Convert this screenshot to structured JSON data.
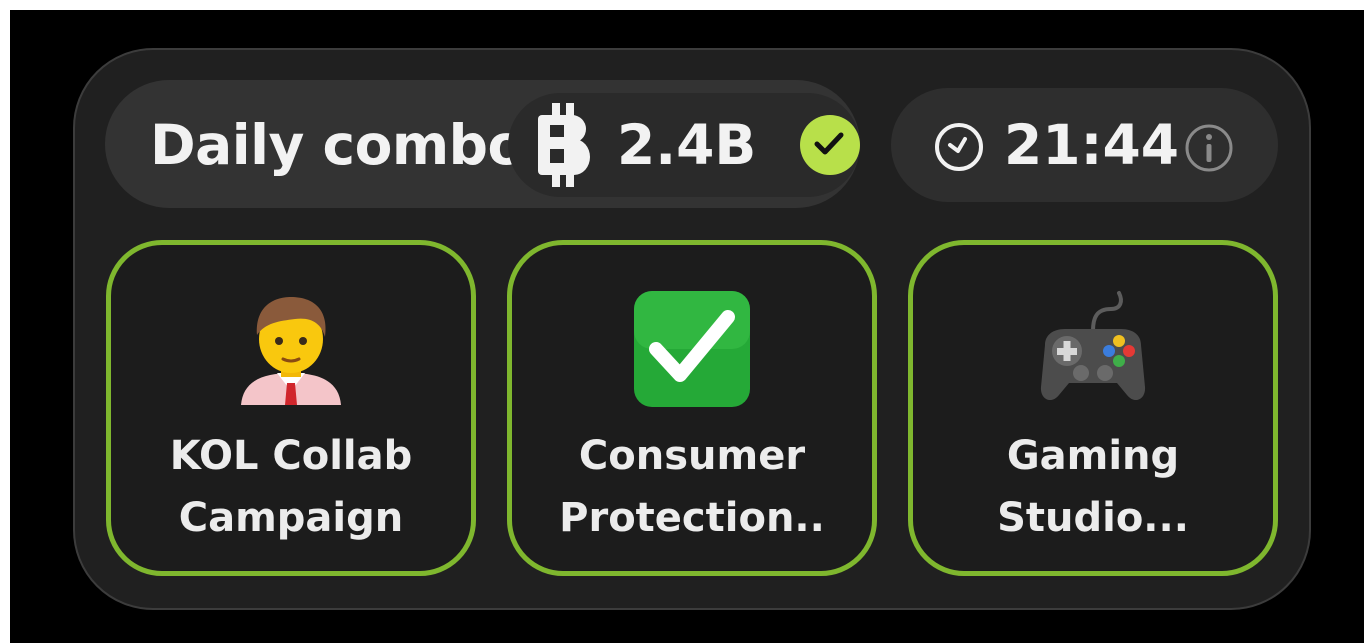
{
  "header": {
    "title": "Daily combo",
    "reward": "2.4B",
    "reward_icon": "coin-icon",
    "completed_icon": "check-badge-icon",
    "timer": "21:44",
    "timer_icon": "clock-icon",
    "info_icon": "info-icon"
  },
  "cards": [
    {
      "line1": "KOL Collab",
      "line2": "Campaign",
      "icon": "person-office-worker-icon"
    },
    {
      "line1": "Consumer",
      "line2": "Protection..",
      "icon": "green-check-icon"
    },
    {
      "line1": "Gaming",
      "line2": "Studio...",
      "icon": "game-controller-icon"
    }
  ],
  "colors": {
    "accent": "#7fb72e",
    "badge": "#b8e04a",
    "panel": "#202020",
    "background": "#000000"
  }
}
